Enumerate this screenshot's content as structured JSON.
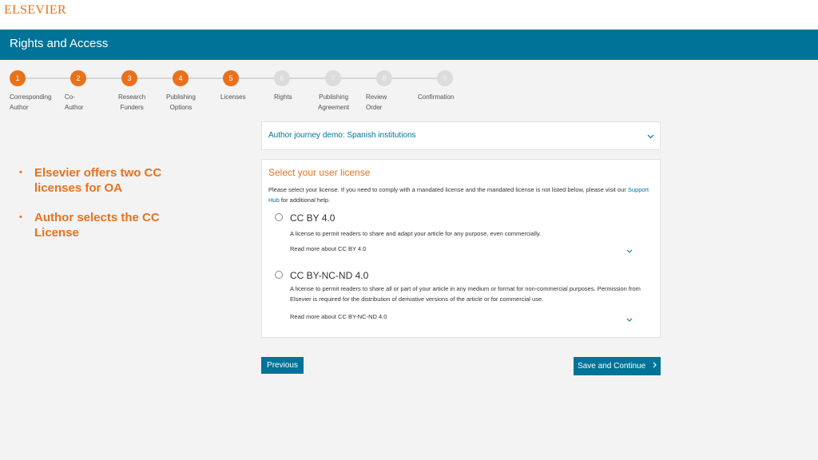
{
  "logo": "ELSEVIER",
  "banner": {
    "title": "Rights and Access"
  },
  "steps": [
    {
      "num": "1",
      "label": "Corresponding\nAuthor",
      "status": "done"
    },
    {
      "num": "2",
      "label": "Co-Author",
      "status": "done"
    },
    {
      "num": "3",
      "label": "Research\nFunders",
      "status": "done"
    },
    {
      "num": "4",
      "label": "Publishing\nOptions",
      "status": "done"
    },
    {
      "num": "5",
      "label": "Licenses",
      "status": "done"
    },
    {
      "num": "6",
      "label": "Rights",
      "status": "todo"
    },
    {
      "num": "7",
      "label": "Publishing\nAgreement",
      "status": "todo"
    },
    {
      "num": "8",
      "label": "Review Order",
      "status": "todo"
    },
    {
      "num": "9",
      "label": "Confirmation",
      "status": "todo"
    }
  ],
  "notes": [
    "Elsevier offers two CC licenses for OA",
    "Author selects the CC License"
  ],
  "journey": {
    "label": "Author journey demo: Spanish institutions"
  },
  "license": {
    "title": "Select your user license",
    "instructions_pre": "Please select your license. If you need to comply with a mandated license and the mandated license is not listed below, please visit our ",
    "instructions_link": "Support Hub",
    "instructions_post": " for additional help.",
    "options": [
      {
        "name": "CC BY 4.0",
        "description": "A license to permit readers to share and adapt your article for any purpose, even commercially.",
        "more": "Read more about CC BY 4.0"
      },
      {
        "name": "CC BY-NC-ND 4.0",
        "description": "A license to permit readers to share all or part of your article in any medium or format for non-commercial purposes. Permission from Elsevier is required for the distribution of derivative versions of the article or for commercial use.",
        "more": "Read more about CC BY-NC-ND 4.0"
      }
    ]
  },
  "buttons": {
    "previous": "Previous",
    "save": "Save and Continue"
  },
  "colors": {
    "brand_orange": "#e9711c",
    "brand_blue": "#007398",
    "step_inactive": "#dcdcdc"
  },
  "icons": {
    "chevron": "chevron-down-icon",
    "arrow": "chevron-right-icon"
  }
}
